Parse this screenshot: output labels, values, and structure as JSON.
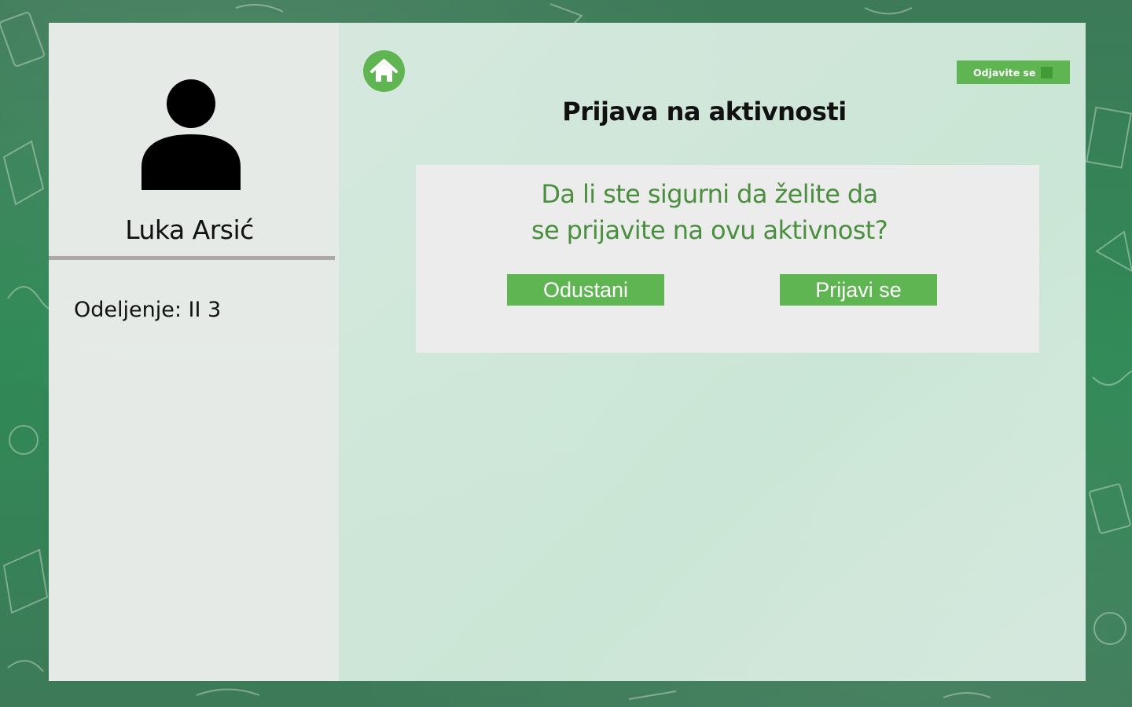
{
  "sidebar": {
    "user_name": "Luka Arsić",
    "class_info": "Odeljenje: II 3"
  },
  "header": {
    "title": "Prijava na aktivnosti",
    "logout_label": "Odjavite se"
  },
  "dialog": {
    "question_line1": "Da li ste sigurni da želite da",
    "question_line2": "se prijavite na ovu aktivnost?",
    "cancel_label": "Odustani",
    "confirm_label": "Prijavi se"
  },
  "icons": {
    "home": "home-icon",
    "avatar": "user-icon",
    "logout": "logout-icon"
  },
  "colors": {
    "accent": "#5fb551",
    "question_text": "#4a8f3e",
    "background": "#3a8a5c"
  }
}
